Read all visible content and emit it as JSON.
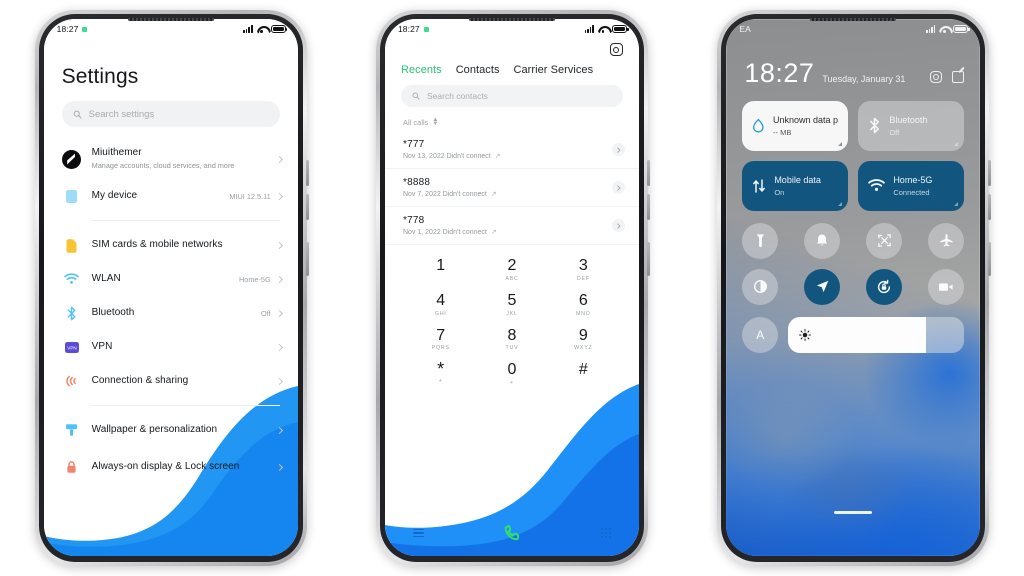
{
  "meta": {
    "accent_green": "#2ec07f",
    "accent_blue": "#1684ff",
    "tile_on": "#12567f",
    "call_green": "#35dd6a"
  },
  "phone1": {
    "status": {
      "time": "18:27",
      "icons": [
        "signal-icon",
        "wifi-icon",
        "battery-icon"
      ]
    },
    "title": "Settings",
    "search": {
      "placeholder": "Search settings",
      "icon": "search-icon"
    },
    "groups": [
      {
        "items": [
          {
            "icon": "account-avatar",
            "name": "Miuithemer",
            "sub": "Manage accounts, cloud services, and more",
            "value": ""
          },
          {
            "icon": "device-icon",
            "name": "My device",
            "sub": "",
            "value": "MIUI 12.5.11"
          }
        ]
      },
      {
        "items": [
          {
            "icon": "sim-icon",
            "name": "SIM cards & mobile networks",
            "sub": "",
            "value": ""
          },
          {
            "icon": "wifi-icon",
            "name": "WLAN",
            "sub": "",
            "value": "Home-5G"
          },
          {
            "icon": "bluetooth-icon",
            "name": "Bluetooth",
            "sub": "",
            "value": "Off"
          },
          {
            "icon": "vpn-icon",
            "name": "VPN",
            "sub": "",
            "value": ""
          },
          {
            "icon": "connection-sharing-icon",
            "name": "Connection & sharing",
            "sub": "",
            "value": ""
          }
        ]
      },
      {
        "items": [
          {
            "icon": "wallpaper-icon",
            "name": "Wallpaper & personalization",
            "sub": "",
            "value": ""
          },
          {
            "icon": "lock-icon",
            "name": "Always-on display & Lock screen",
            "sub": "",
            "value": ""
          }
        ]
      }
    ]
  },
  "phone2": {
    "status": {
      "time": "18:27"
    },
    "settings_icon": "gear-icon",
    "tabs": [
      {
        "label": "Recents",
        "active": true
      },
      {
        "label": "Contacts",
        "active": false
      },
      {
        "label": "Carrier Services",
        "active": false
      }
    ],
    "search": {
      "placeholder": "Search contacts",
      "icon": "search-icon"
    },
    "filter": {
      "label": "All calls",
      "icon": "sort-updown-icon"
    },
    "calls": [
      {
        "number": "*777",
        "meta": "Nov 13, 2022 Didn't connect",
        "direction": "outgoing-arrow-icon"
      },
      {
        "number": "*8888",
        "meta": "Nov 7, 2022 Didn't connect",
        "direction": "outgoing-arrow-icon"
      },
      {
        "number": "*778",
        "meta": "Nov 1, 2022 Didn't connect",
        "direction": "outgoing-arrow-icon"
      }
    ],
    "dialpad": [
      [
        {
          "d": "1",
          "l": ""
        },
        {
          "d": "2",
          "l": "ABC"
        },
        {
          "d": "3",
          "l": "DEF"
        }
      ],
      [
        {
          "d": "4",
          "l": "GHI"
        },
        {
          "d": "5",
          "l": "JKL"
        },
        {
          "d": "6",
          "l": "MNO"
        }
      ],
      [
        {
          "d": "7",
          "l": "PQRS"
        },
        {
          "d": "8",
          "l": "TUV"
        },
        {
          "d": "9",
          "l": "WXYZ"
        }
      ],
      [
        {
          "d": "*",
          "l": "+"
        },
        {
          "d": "0",
          "l": "+"
        },
        {
          "d": "#",
          "l": ""
        }
      ]
    ],
    "bottom": {
      "menu": "menu-icon",
      "call": "call-icon",
      "keypad": "keypad-icon"
    }
  },
  "phone3": {
    "status": {
      "carrier": "EA"
    },
    "time": "18:27",
    "date": "Tuesday, January 31",
    "header_icons": [
      "settings-icon",
      "edit-icon"
    ],
    "big_tiles": [
      {
        "icon": "data-usage-icon",
        "name": "Unknown data plan",
        "sub": "-- MB",
        "state": "white"
      },
      {
        "icon": "bluetooth-icon",
        "name": "Bluetooth",
        "sub": "Off",
        "state": "frost"
      },
      {
        "icon": "mobile-data-icon",
        "name": "Mobile data",
        "sub": "On",
        "state": "on"
      },
      {
        "icon": "wifi-icon",
        "name": "Home-5G",
        "sub": "Connected",
        "state": "on"
      }
    ],
    "toggles": [
      [
        {
          "icon": "flashlight-icon",
          "on": false
        },
        {
          "icon": "ringer-bell-icon",
          "on": false
        },
        {
          "icon": "screenshot-icon",
          "on": false
        },
        {
          "icon": "airplane-mode-icon",
          "on": false
        }
      ],
      [
        {
          "icon": "dark-mode-icon",
          "on": false
        },
        {
          "icon": "location-icon",
          "on": true
        },
        {
          "icon": "auto-rotate-lock-icon",
          "on": true
        },
        {
          "icon": "screen-recorder-icon",
          "on": false
        }
      ]
    ],
    "brightness": {
      "auto_label": "A",
      "icon": "brightness-sun-icon",
      "percent": 78
    }
  }
}
